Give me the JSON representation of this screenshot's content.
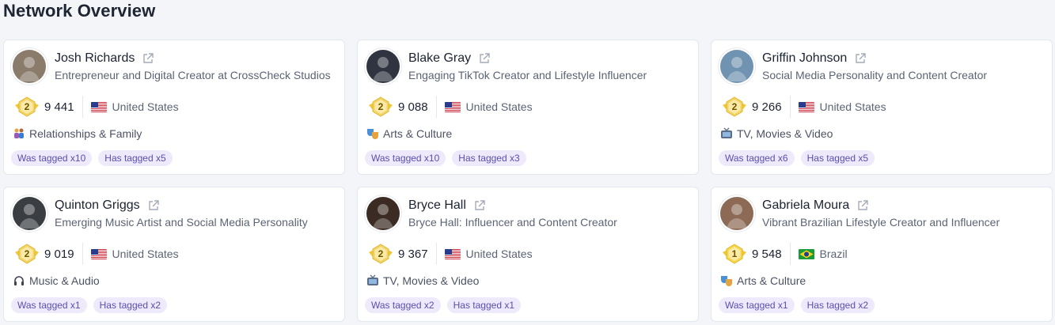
{
  "page": {
    "title": "Network Overview"
  },
  "cards": [
    {
      "name": "Josh Richards",
      "bio": "Entrepreneur and Digital Creator at CrossCheck Studios",
      "rank": "2",
      "score": "9 441",
      "country": "United States",
      "flag": "us-flag",
      "category": "Relationships & Family",
      "category_icon": "family-icon",
      "tag_tagged": "Was tagged x10",
      "tag_has_tagged": "Has tagged x5",
      "avatar_color": "#8a7b6a"
    },
    {
      "name": "Blake Gray",
      "bio": "Engaging TikTok Creator and Lifestyle Influencer",
      "rank": "2",
      "score": "9 088",
      "country": "United States",
      "flag": "us-flag",
      "category": "Arts & Culture",
      "category_icon": "theater-masks-icon",
      "tag_tagged": "Was tagged x10",
      "tag_has_tagged": "Has tagged x3",
      "avatar_color": "#2f3440"
    },
    {
      "name": "Griffin Johnson",
      "bio": "Social Media Personality and Content Creator",
      "rank": "2",
      "score": "9 266",
      "country": "United States",
      "flag": "us-flag",
      "category": "TV, Movies & Video",
      "category_icon": "television-icon",
      "tag_tagged": "Was tagged x6",
      "tag_has_tagged": "Has tagged x5",
      "avatar_color": "#6f93b0"
    },
    {
      "name": "Quinton Griggs",
      "bio": "Emerging Music Artist and Social Media Personality",
      "rank": "2",
      "score": "9 019",
      "country": "United States",
      "flag": "us-flag",
      "category": "Music & Audio",
      "category_icon": "headphones-icon",
      "tag_tagged": "Was tagged x1",
      "tag_has_tagged": "Has tagged x2",
      "avatar_color": "#3a3d42"
    },
    {
      "name": "Bryce Hall",
      "bio": "Bryce Hall: Influencer and Content Creator",
      "rank": "2",
      "score": "9 367",
      "country": "United States",
      "flag": "us-flag",
      "category": "TV, Movies & Video",
      "category_icon": "television-icon",
      "tag_tagged": "Was tagged x2",
      "tag_has_tagged": "Has tagged x1",
      "avatar_color": "#3b2b22"
    },
    {
      "name": "Gabriela Moura",
      "bio": "Vibrant Brazilian Lifestyle Creator and Influencer",
      "rank": "1",
      "score": "9 548",
      "country": "Brazil",
      "flag": "brazil-flag",
      "category": "Arts & Culture",
      "category_icon": "theater-masks-icon",
      "tag_tagged": "Was tagged x1",
      "tag_has_tagged": "Has tagged x2",
      "avatar_color": "#8c6a55"
    }
  ],
  "colors": {
    "accent_tag_bg": "#eeeafb",
    "accent_tag_text": "#5a4fb0",
    "badge_gold": "#f4d03f"
  }
}
